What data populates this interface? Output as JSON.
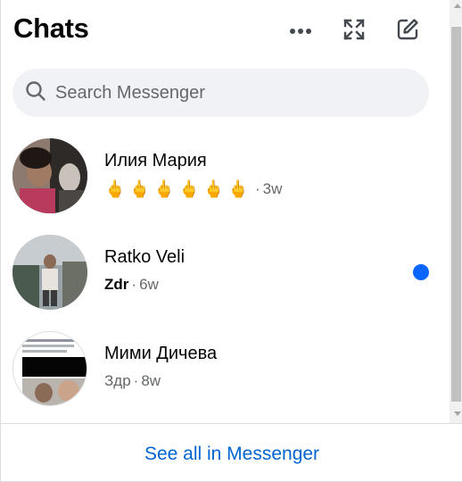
{
  "header": {
    "title": "Chats",
    "icons": [
      "more-icon",
      "expand-icon",
      "compose-icon"
    ]
  },
  "search": {
    "placeholder": "Search Messenger"
  },
  "chats": [
    {
      "name": "Илия Мария",
      "preview": "🖕🖕🖕🖕🖕🖕",
      "time": "3w",
      "unread": false
    },
    {
      "name": "Ratko Veli",
      "preview": "Zdr",
      "time": "6w",
      "unread": true
    },
    {
      "name": "Мими Дичева",
      "preview": "Здр",
      "time": "8w",
      "unread": false
    }
  ],
  "footer": {
    "link": "See all in Messenger"
  },
  "colors": {
    "accent": "#0866ff",
    "link": "#0064d1",
    "secondary_text": "#65676b",
    "search_bg": "#f0f2f5"
  }
}
